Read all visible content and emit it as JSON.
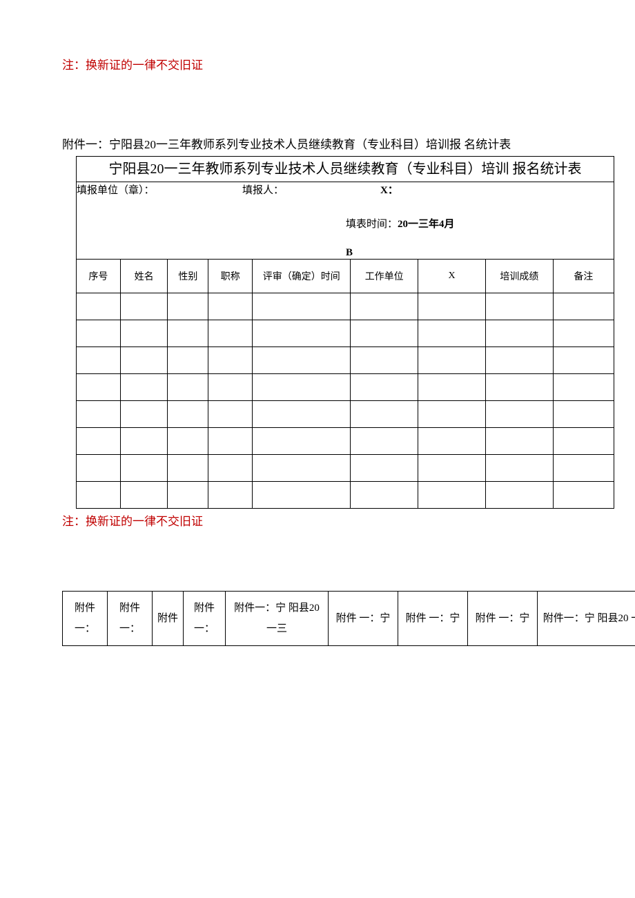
{
  "note_top": "注：换新证的一律不交旧证",
  "attachment_title": "附件一：宁阳县20一三年教师系列专业技术人员继续教育（专业科目）培训报 名统计表",
  "table_title": "宁阳县20一三年教师系列专业技术人员继续教育（专业科目）培训 报名统计表",
  "info": {
    "unit_label": "填报单位（章）：",
    "filler_label": "填报人：",
    "x_label": "X：",
    "filling_time_label": "填表时间：",
    "filling_time_value": "20一三年4月",
    "b": "B"
  },
  "columns": [
    "序号",
    "姓名",
    "性别",
    "职称",
    "评审（确定）时间",
    "工作单位",
    "X",
    "培训成绩",
    "备注"
  ],
  "row_count": 8,
  "note_bottom": "注：换新证的一律不交旧证",
  "bottom_row": [
    "附件一：",
    "附件一：",
    "附件",
    "附件一：",
    "附件一：宁 阳县20 一三",
    "附件 一：宁",
    "附件 一：宁",
    "附件 一：宁",
    "附件一：宁 阳县20 一"
  ]
}
